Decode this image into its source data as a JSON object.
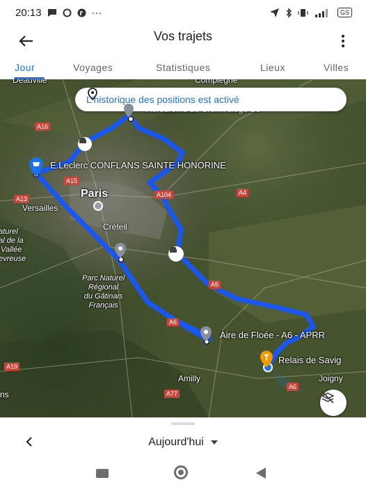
{
  "status_bar": {
    "time": "20:13",
    "dots": "···",
    "battery": "GS"
  },
  "header": {
    "title": "Vos trajets"
  },
  "tabs": [
    {
      "label": "Jour",
      "active": true
    },
    {
      "label": "Voyages"
    },
    {
      "label": "Statistiques"
    },
    {
      "label": "Lieux"
    },
    {
      "label": "Villes"
    }
  ],
  "map": {
    "banner": "L'historique des positions est activé",
    "labels": {
      "deauville": "Deauville",
      "compiegne": "Compiègne",
      "top_right_poi": "Aérodrome de Creil... siège So",
      "leclerc": "E.Leclerc CONFLANS SAINTE HONORINE",
      "paris": "Paris",
      "versailles": "Versailles",
      "creteil": "Créteil",
      "pnr_left": "naturel\nnal de la\ne Vallée\nhevreuse",
      "pnr_gatinais": "Parc Naturel\nRégional\ndu Gâtinais\nFrançais",
      "aire_floee": "Aire de Floée - A6 - APRR",
      "relais": "Relais de Savig",
      "amilly": "Amilly",
      "joigny": "Joigny",
      "ns": "ns"
    },
    "roads": [
      "A16",
      "A15",
      "A13",
      "A104",
      "A4",
      "A5",
      "A6",
      "A6",
      "A77",
      "A19",
      "A6"
    ],
    "route_color": "#1a56f0",
    "pin_color": "#1a73e8"
  },
  "bottom": {
    "date": "Aujourd'hui"
  },
  "colors": {
    "accent": "#1a73e8",
    "text": "#202124",
    "muted": "#5f6368"
  }
}
